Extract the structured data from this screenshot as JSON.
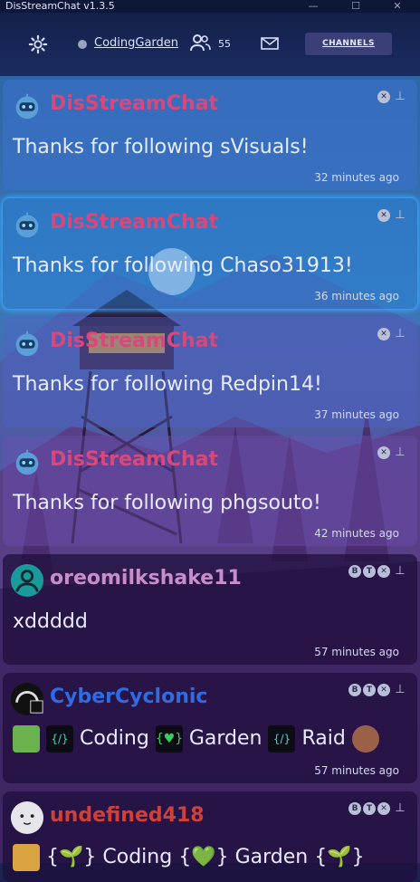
{
  "app": {
    "title": "DisStreamChat v1.3.5"
  },
  "window_controls": {
    "minimize": "—",
    "maximize": "☐",
    "close": "✕"
  },
  "header": {
    "settings_icon": "gear-icon",
    "status_color": "#9aa3bd",
    "channel_name": "CodingGarden",
    "viewer_count": "55",
    "mail_icon": "mail-icon",
    "channels_label": "CHANNELS"
  },
  "colors": {
    "disstream": "#d9477b",
    "oreomilkshake11": "#c98ec8",
    "CyberCyclonic": "#2f6be3",
    "undefined418": "#d04039"
  },
  "messages": [
    {
      "user": "DisStreamChat",
      "text": "Thanks for following sVisuals!",
      "time": "32 minutes ago",
      "type": "system"
    },
    {
      "user": "DisStreamChat",
      "text": "Thanks for following Chaso31913!",
      "time": "36 minutes ago",
      "type": "system"
    },
    {
      "user": "DisStreamChat",
      "text": "Thanks for following Redpin14!",
      "time": "37 minutes ago",
      "type": "system"
    },
    {
      "user": "DisStreamChat",
      "text": "Thanks for following phgsouto!",
      "time": "42 minutes ago",
      "type": "system"
    },
    {
      "user": "oreomilkshake11",
      "text": "xddddd",
      "time": "57 minutes ago",
      "type": "user"
    },
    {
      "user": "CyberCyclonic",
      "text_parts": [
        "Coding",
        "Garden",
        "Raid"
      ],
      "time": "57 minutes ago",
      "type": "user"
    },
    {
      "user": "undefined418",
      "text_parts": [
        "Coding",
        "Garden"
      ],
      "time": "",
      "type": "user"
    }
  ],
  "control_labels": {
    "ban": "B",
    "timeout": "T",
    "delete": "✕",
    "pin": "📌"
  }
}
